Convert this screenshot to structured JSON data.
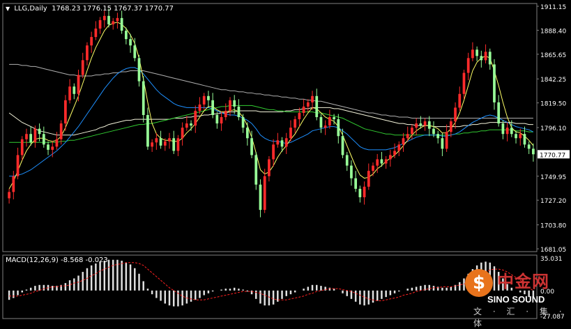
{
  "header": {
    "symbol": "LLG,Daily",
    "ohlc": "1768.23 1776.15 1767.37 1770.77"
  },
  "macd": {
    "label": "MACD(12,26,9) -8.568 -0.023",
    "axis_labels": [
      "35.031",
      "0.00",
      "-27.087"
    ]
  },
  "watermark": {
    "cn": "中金网",
    "en": "SINO SOUND",
    "sub": "文 · 汇 · 集 · 体",
    "logo": "$"
  },
  "colors": {
    "background": "#000000",
    "up_candle": "#ff2b2b",
    "down_candle": "#98ff98",
    "ma_fast": "#ffff66",
    "ma_mid": "#1e90ff",
    "ma_green": "#32cd32",
    "ma_white": "#f5f5dc",
    "ma_gray": "#b0b0b0",
    "macd_hist": "#e0e0e0",
    "macd_signal": "#ff2020"
  },
  "chart_data": {
    "type": "candlestick",
    "ylim": [
      1681.05,
      1911.15
    ],
    "y_ticks": [
      "1911.15",
      "1888.40",
      "1865.65",
      "1842.25",
      "1819.50",
      "1796.10",
      "1770.77",
      "1749.95",
      "1727.20",
      "1703.80",
      "1681.05"
    ],
    "current_price": "1770.77",
    "closes": [
      1735,
      1750,
      1770,
      1785,
      1790,
      1782,
      1795,
      1790,
      1780,
      1775,
      1778,
      1785,
      1800,
      1822,
      1835,
      1828,
      1846,
      1860,
      1874,
      1882,
      1890,
      1898,
      1902,
      1894,
      1897,
      1900,
      1888,
      1880,
      1874,
      1862,
      1840,
      1808,
      1778,
      1782,
      1786,
      1779,
      1783,
      1786,
      1774,
      1786,
      1796,
      1800,
      1798,
      1812,
      1818,
      1826,
      1822,
      1808,
      1800,
      1806,
      1812,
      1822,
      1816,
      1806,
      1796,
      1786,
      1770,
      1742,
      1718,
      1750,
      1766,
      1780,
      1784,
      1778,
      1786,
      1796,
      1804,
      1810,
      1816,
      1820,
      1826,
      1806,
      1796,
      1798,
      1806,
      1804,
      1788,
      1770,
      1760,
      1748,
      1738,
      1730,
      1740,
      1755,
      1760,
      1766,
      1762,
      1766,
      1770,
      1774,
      1780,
      1786,
      1790,
      1796,
      1800,
      1798,
      1802,
      1795,
      1790,
      1786,
      1776,
      1792,
      1802,
      1815,
      1828,
      1848,
      1862,
      1870,
      1864,
      1860,
      1868,
      1856,
      1820,
      1800,
      1790,
      1796,
      1790,
      1786,
      1790,
      1780,
      1776,
      1770.77
    ],
    "ma_fast": [
      1738,
      1745,
      1755,
      1765,
      1774,
      1780,
      1785,
      1786,
      1786,
      1784,
      1783,
      1784,
      1788,
      1796,
      1806,
      1816,
      1826,
      1838,
      1850,
      1862,
      1872,
      1880,
      1888,
      1893,
      1895,
      1896,
      1894,
      1890,
      1884,
      1876,
      1862,
      1842,
      1820,
      1800,
      1790,
      1786,
      1784,
      1784,
      1783,
      1783,
      1786,
      1791,
      1795,
      1800,
      1806,
      1812,
      1816,
      1816,
      1813,
      1811,
      1811,
      1812,
      1813,
      1811,
      1806,
      1798,
      1787,
      1772,
      1756,
      1752,
      1754,
      1760,
      1768,
      1774,
      1779,
      1785,
      1790,
      1797,
      1804,
      1810,
      1815,
      1814,
      1810,
      1806,
      1804,
      1802,
      1797,
      1789,
      1779,
      1769,
      1759,
      1751,
      1748,
      1749,
      1752,
      1757,
      1760,
      1764,
      1767,
      1770,
      1774,
      1779,
      1784,
      1789,
      1793,
      1796,
      1798,
      1798,
      1797,
      1795,
      1791,
      1791,
      1795,
      1801,
      1810,
      1822,
      1836,
      1850,
      1858,
      1862,
      1864,
      1862,
      1850,
      1836,
      1820,
      1806,
      1796,
      1792,
      1791,
      1788,
      1784,
      1779
    ],
    "ma_mid": [
      1750,
      1750,
      1751,
      1752,
      1754,
      1756,
      1759,
      1762,
      1765,
      1768,
      1771,
      1774,
      1778,
      1782,
      1787,
      1792,
      1797,
      1803,
      1809,
      1815,
      1821,
      1827,
      1833,
      1838,
      1843,
      1847,
      1850,
      1852,
      1853,
      1853,
      1851,
      1847,
      1842,
      1837,
      1832,
      1828,
      1825,
      1822,
      1819,
      1817,
      1816,
      1815,
      1815,
      1815,
      1815,
      1815,
      1815,
      1814,
      1812,
      1810,
      1809,
      1808,
      1808,
      1807,
      1805,
      1803,
      1800,
      1795,
      1789,
      1786,
      1784,
      1783,
      1783,
      1782,
      1781,
      1782,
      1784,
      1786,
      1788,
      1790,
      1793,
      1794,
      1795,
      1796,
      1797,
      1797,
      1796,
      1793,
      1790,
      1786,
      1782,
      1778,
      1776,
      1775,
      1775,
      1775,
      1775,
      1775,
      1776,
      1777,
      1779,
      1781,
      1783,
      1785,
      1787,
      1788,
      1789,
      1789,
      1789,
      1789,
      1788,
      1788,
      1789,
      1790,
      1792,
      1795,
      1798,
      1801,
      1803,
      1805,
      1807,
      1808,
      1807,
      1805,
      1803,
      1801,
      1799,
      1797,
      1796,
      1795,
      1794,
      1792
    ],
    "ma_green": [
      1782,
      1782,
      1782,
      1782,
      1782,
      1782,
      1782,
      1782,
      1782,
      1782,
      1782,
      1782,
      1783,
      1783,
      1784,
      1784,
      1785,
      1786,
      1787,
      1788,
      1789,
      1790,
      1791,
      1792,
      1793,
      1794,
      1795,
      1796,
      1797,
      1798,
      1799,
      1799,
      1800,
      1800,
      1801,
      1802,
      1803,
      1804,
      1805,
      1806,
      1807,
      1808,
      1809,
      1810,
      1811,
      1812,
      1813,
      1814,
      1815,
      1816,
      1816,
      1817,
      1817,
      1817,
      1817,
      1817,
      1817,
      1816,
      1815,
      1814,
      1813,
      1813,
      1812,
      1812,
      1811,
      1811,
      1811,
      1811,
      1811,
      1811,
      1811,
      1810,
      1810,
      1809,
      1808,
      1807,
      1806,
      1805,
      1803,
      1801,
      1799,
      1797,
      1795,
      1794,
      1793,
      1792,
      1791,
      1790,
      1790,
      1789,
      1789,
      1789,
      1789,
      1789,
      1789,
      1789,
      1789,
      1789,
      1789,
      1789,
      1789,
      1789,
      1789,
      1790,
      1790,
      1791,
      1791,
      1792,
      1792,
      1793,
      1793,
      1794,
      1794,
      1794,
      1794,
      1794,
      1794,
      1793,
      1793,
      1793,
      1792,
      1792
    ],
    "ma_white": [
      1810,
      1807,
      1804,
      1801,
      1799,
      1797,
      1795,
      1793,
      1792,
      1791,
      1790,
      1789,
      1789,
      1789,
      1789,
      1789,
      1790,
      1791,
      1792,
      1793,
      1794,
      1796,
      1797,
      1799,
      1800,
      1801,
      1802,
      1803,
      1803,
      1804,
      1804,
      1804,
      1804,
      1804,
      1804,
      1804,
      1804,
      1804,
      1805,
      1805,
      1805,
      1806,
      1806,
      1807,
      1807,
      1808,
      1808,
      1809,
      1809,
      1810,
      1810,
      1811,
      1811,
      1812,
      1812,
      1812,
      1812,
      1812,
      1811,
      1811,
      1811,
      1811,
      1811,
      1811,
      1812,
      1812,
      1813,
      1813,
      1814,
      1814,
      1815,
      1815,
      1815,
      1815,
      1815,
      1814,
      1814,
      1813,
      1812,
      1811,
      1810,
      1809,
      1808,
      1807,
      1806,
      1805,
      1804,
      1803,
      1802,
      1801,
      1800,
      1800,
      1799,
      1799,
      1798,
      1798,
      1798,
      1798,
      1797,
      1797,
      1797,
      1797,
      1797,
      1797,
      1797,
      1798,
      1798,
      1799,
      1799,
      1800,
      1800,
      1801,
      1801,
      1801,
      1801,
      1801,
      1801,
      1800,
      1800,
      1800,
      1799,
      1799
    ],
    "ma_gray": [
      1856,
      1856,
      1856,
      1855,
      1855,
      1854,
      1854,
      1853,
      1852,
      1851,
      1850,
      1849,
      1848,
      1847,
      1846,
      1846,
      1845,
      1845,
      1845,
      1845,
      1846,
      1846,
      1847,
      1847,
      1848,
      1848,
      1849,
      1849,
      1850,
      1850,
      1850,
      1850,
      1849,
      1848,
      1847,
      1846,
      1845,
      1844,
      1843,
      1842,
      1841,
      1840,
      1839,
      1838,
      1837,
      1836,
      1835,
      1834,
      1833,
      1832,
      1832,
      1831,
      1831,
      1830,
      1830,
      1829,
      1829,
      1828,
      1828,
      1827,
      1827,
      1826,
      1826,
      1825,
      1825,
      1824,
      1824,
      1823,
      1823,
      1822,
      1822,
      1821,
      1821,
      1820,
      1819,
      1818,
      1817,
      1816,
      1815,
      1814,
      1813,
      1812,
      1811,
      1810,
      1810,
      1809,
      1808,
      1808,
      1807,
      1807,
      1806,
      1806,
      1806,
      1805,
      1805,
      1805,
      1805,
      1805,
      1805,
      1805,
      1805,
      1805,
      1805,
      1805,
      1805,
      1805,
      1805,
      1805,
      1805,
      1805,
      1805,
      1805,
      1805,
      1805,
      1805,
      1805,
      1805,
      1805,
      1805,
      1805,
      1805,
      1805
    ],
    "macd_hist": [
      -10,
      -8,
      -5,
      -2,
      1,
      3,
      5,
      6,
      6,
      6,
      5,
      5,
      6,
      8,
      11,
      13,
      16,
      20,
      24,
      27,
      29,
      31,
      32,
      33,
      33,
      33,
      32,
      30,
      28,
      24,
      18,
      10,
      2,
      -4,
      -8,
      -11,
      -14,
      -16,
      -17,
      -17,
      -16,
      -14,
      -12,
      -10,
      -8,
      -5,
      -3,
      -1,
      0,
      1,
      2,
      2,
      3,
      2,
      1,
      -1,
      -4,
      -9,
      -14,
      -16,
      -16,
      -15,
      -12,
      -9,
      -6,
      -4,
      -2,
      0,
      2,
      4,
      6,
      6,
      5,
      4,
      3,
      2,
      0,
      -3,
      -6,
      -9,
      -12,
      -15,
      -16,
      -15,
      -13,
      -11,
      -9,
      -7,
      -5,
      -3,
      -1,
      0,
      2,
      3,
      4,
      5,
      6,
      6,
      5,
      4,
      3,
      3,
      4,
      6,
      9,
      13,
      18,
      23,
      27,
      30,
      31,
      30,
      26,
      20,
      13,
      7,
      3,
      0,
      -2,
      -4,
      -7,
      -8.568
    ],
    "macd_signal": [
      -6,
      -6,
      -6,
      -5,
      -4,
      -3,
      -1,
      0,
      2,
      3,
      4,
      4,
      5,
      5,
      6,
      8,
      9,
      11,
      13,
      16,
      18,
      21,
      23,
      25,
      27,
      28,
      29,
      30,
      30,
      30,
      29,
      27,
      23,
      19,
      15,
      11,
      7,
      3,
      0,
      -3,
      -6,
      -8,
      -9,
      -10,
      -10,
      -10,
      -9,
      -8,
      -7,
      -6,
      -5,
      -4,
      -3,
      -2,
      -1,
      -1,
      -1,
      -2,
      -3,
      -5,
      -7,
      -9,
      -10,
      -10,
      -10,
      -9,
      -8,
      -7,
      -6,
      -4,
      -3,
      -1,
      0,
      1,
      2,
      2,
      2,
      1,
      0,
      -1,
      -3,
      -5,
      -7,
      -9,
      -10,
      -11,
      -11,
      -10,
      -9,
      -8,
      -7,
      -5,
      -4,
      -3,
      -1,
      0,
      1,
      2,
      3,
      3,
      4,
      4,
      4,
      5,
      6,
      7,
      9,
      11,
      14,
      17,
      20,
      22,
      23,
      23,
      22,
      20,
      17,
      14,
      11,
      7,
      3,
      -0.023
    ],
    "macd_ylim": [
      -27.087,
      35.031
    ]
  }
}
